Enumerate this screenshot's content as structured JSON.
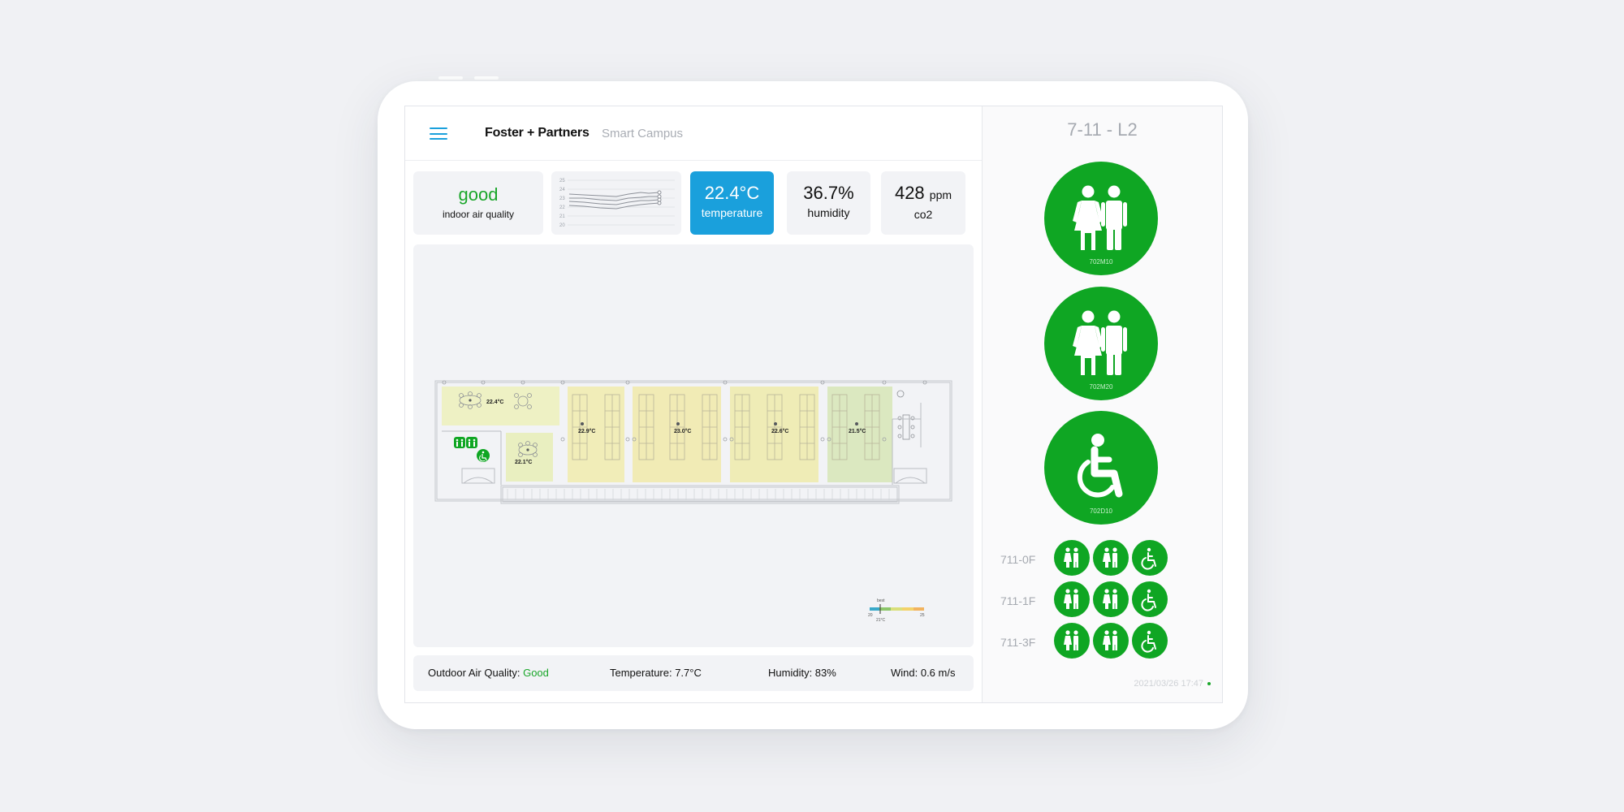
{
  "header": {
    "brand": "Foster + Partners",
    "subtitle": "Smart Campus"
  },
  "cards": {
    "air_quality": {
      "value": "good",
      "label": "indoor air quality"
    },
    "trend_ticks": [
      "25",
      "24",
      "23",
      "22",
      "21",
      "20"
    ],
    "temperature": {
      "value": "22.4°C",
      "label": "temperature"
    },
    "humidity": {
      "value": "36.7%",
      "label": "humidity"
    },
    "co2": {
      "value": "428",
      "unit": "ppm",
      "label": "co2"
    }
  },
  "floorplan": {
    "zones": [
      {
        "temp": "22.4°C"
      },
      {
        "temp": "22.1°C"
      },
      {
        "temp": "22.9°C"
      },
      {
        "temp": "23.0°C"
      },
      {
        "temp": "22.6°C"
      },
      {
        "temp": "21.5°C"
      }
    ],
    "scale": {
      "top": "best",
      "min": "20",
      "max": "25",
      "mid": "21°C"
    }
  },
  "outdoor": {
    "air_quality_label": "Outdoor Air Quality:",
    "air_quality_value": "Good",
    "temperature": "Temperature: 7.7°C",
    "humidity": "Humidity: 83%",
    "wind": "Wind: 0.6 m/s"
  },
  "sidebar": {
    "title": "7-11 - L2",
    "restrooms": [
      {
        "code": "702M10",
        "icon": "unisex-restroom-icon"
      },
      {
        "code": "702M20",
        "icon": "unisex-restroom-icon"
      },
      {
        "code": "702D10",
        "icon": "accessible-restroom-icon"
      }
    ],
    "floors": [
      {
        "label": "711-0F"
      },
      {
        "label": "711-1F"
      },
      {
        "label": "711-3F"
      }
    ],
    "timestamp": "2021/03/26 17:47"
  },
  "colors": {
    "accent": "#1aa0dc",
    "good": "#1aa62a",
    "available": "#0fa623"
  }
}
